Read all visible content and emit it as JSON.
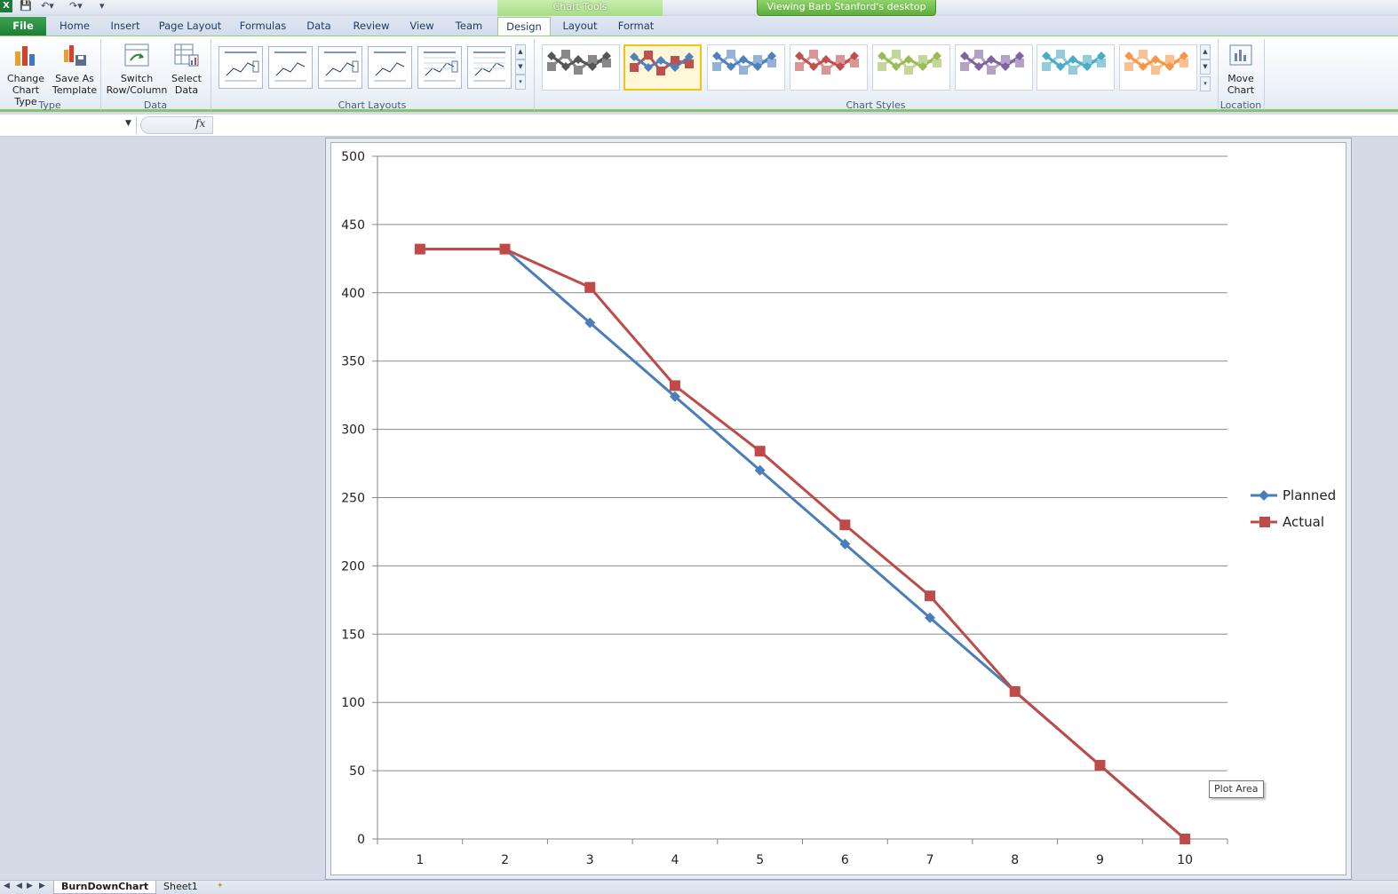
{
  "titlebar": {
    "chart_tools": "Chart Tools",
    "viewing_banner": "Viewing Barb Stanford's desktop",
    "excel_logo": "X"
  },
  "tabs": [
    "File",
    "Home",
    "Insert",
    "Page Layout",
    "Formulas",
    "Data",
    "Review",
    "View",
    "Team",
    "Design",
    "Layout",
    "Format"
  ],
  "active_tab": "Design",
  "ribbon": {
    "type_group": {
      "label": "Type",
      "change_chart_type": [
        "Change",
        "Chart Type"
      ],
      "save_as_template": [
        "Save As",
        "Template"
      ]
    },
    "data_group": {
      "label": "Data",
      "switch_row_column": [
        "Switch",
        "Row/Column"
      ],
      "select_data": [
        "Select",
        "Data"
      ]
    },
    "layouts_group": {
      "label": "Chart Layouts"
    },
    "styles_group": {
      "label": "Chart Styles",
      "style_colors": [
        {
          "line": "#555555",
          "marker": "#888888"
        },
        {
          "line": "#4f81bd",
          "marker": "#c0504d"
        },
        {
          "line": "#4f81bd",
          "marker": "#95b3d7"
        },
        {
          "line": "#c0504d",
          "marker": "#d99694"
        },
        {
          "line": "#9bbb59",
          "marker": "#c3d69b"
        },
        {
          "line": "#8064a2",
          "marker": "#b3a2c7"
        },
        {
          "line": "#4bacc6",
          "marker": "#93cddd"
        },
        {
          "line": "#f79646",
          "marker": "#fac08f"
        }
      ]
    },
    "location_group": {
      "label": "Location",
      "move_chart": [
        "Move",
        "Chart"
      ]
    }
  },
  "formula_bar": {
    "fx": "fx"
  },
  "chart_data": {
    "type": "line",
    "categories": [
      1,
      2,
      3,
      4,
      5,
      6,
      7,
      8,
      9,
      10
    ],
    "series": [
      {
        "name": "Planned",
        "color": "#4a7ebb",
        "marker": "diamond",
        "values": [
          432,
          432,
          378,
          324,
          270,
          216,
          162,
          108,
          54,
          0
        ]
      },
      {
        "name": "Actual",
        "color": "#be4b48",
        "marker": "square",
        "values": [
          432,
          432,
          404,
          332,
          284,
          230,
          178,
          108,
          54,
          0
        ]
      }
    ],
    "ylim": [
      0,
      500
    ],
    "ytick_step": 50,
    "grid": true,
    "legend": "right"
  },
  "tooltip": "Plot Area",
  "sheet_tabs": [
    "BurnDownChart",
    "Sheet1"
  ]
}
